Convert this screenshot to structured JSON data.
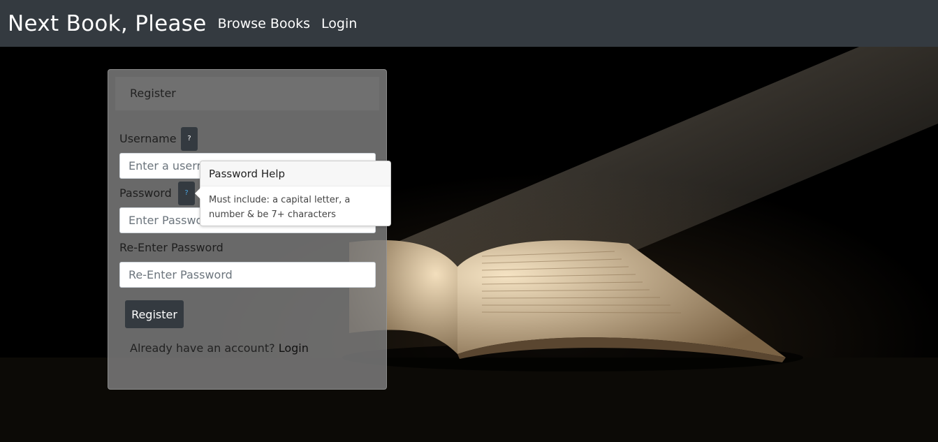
{
  "navbar": {
    "brand": "Next Book, Please",
    "links": [
      "Browse Books",
      "Login"
    ]
  },
  "card": {
    "header": "Register",
    "username_label": "Username",
    "username_placeholder": "Enter a username",
    "password_label": "Password",
    "password_placeholder": "Enter Password",
    "reenter_label": "Re-Enter Password",
    "reenter_placeholder": "Re-Enter Password",
    "help_glyph": "?",
    "submit_label": "Register",
    "footer_text": "Already have an account?",
    "footer_link": "Login"
  },
  "popover": {
    "title": "Password Help",
    "body": "Must include: a capital letter, a number & be 7+ characters"
  },
  "colors": {
    "navbar": "#343a40",
    "button": "#343a40"
  }
}
